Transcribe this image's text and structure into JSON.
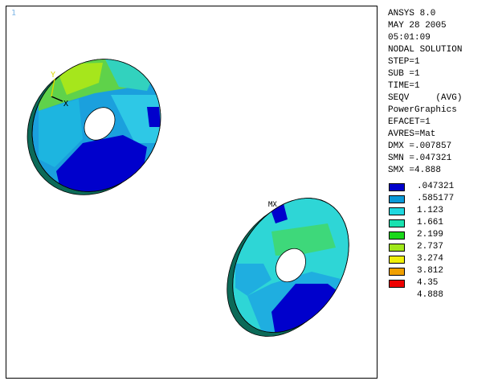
{
  "viewport": {
    "window_number": "1"
  },
  "info_lines": [
    "ANSYS 8.0",
    "MAY 28 2005",
    "05:01:09",
    "NODAL SOLUTION",
    "STEP=1",
    "SUB =1",
    "TIME=1",
    "SEQV     (AVG)",
    "PowerGraphics",
    "EFACET=1",
    "AVRES=Mat",
    "DMX =.007857",
    "SMN =.047321",
    "SMX =4.888"
  ],
  "legend": {
    "values": [
      ".047321",
      ".585177",
      "1.123",
      "1.661",
      "2.199",
      "2.737",
      "3.274",
      "3.812",
      "4.35",
      "4.888"
    ],
    "colors": [
      "#0000cc",
      "#0a9ad8",
      "#20d8e0",
      "#1ae2b0",
      "#1ad81a",
      "#a0e81a",
      "#f0f00a",
      "#f0a000",
      "#ee0000"
    ]
  },
  "annotations": {
    "mx_label": "MX",
    "axis_y": "Y",
    "axis_x": "X"
  }
}
